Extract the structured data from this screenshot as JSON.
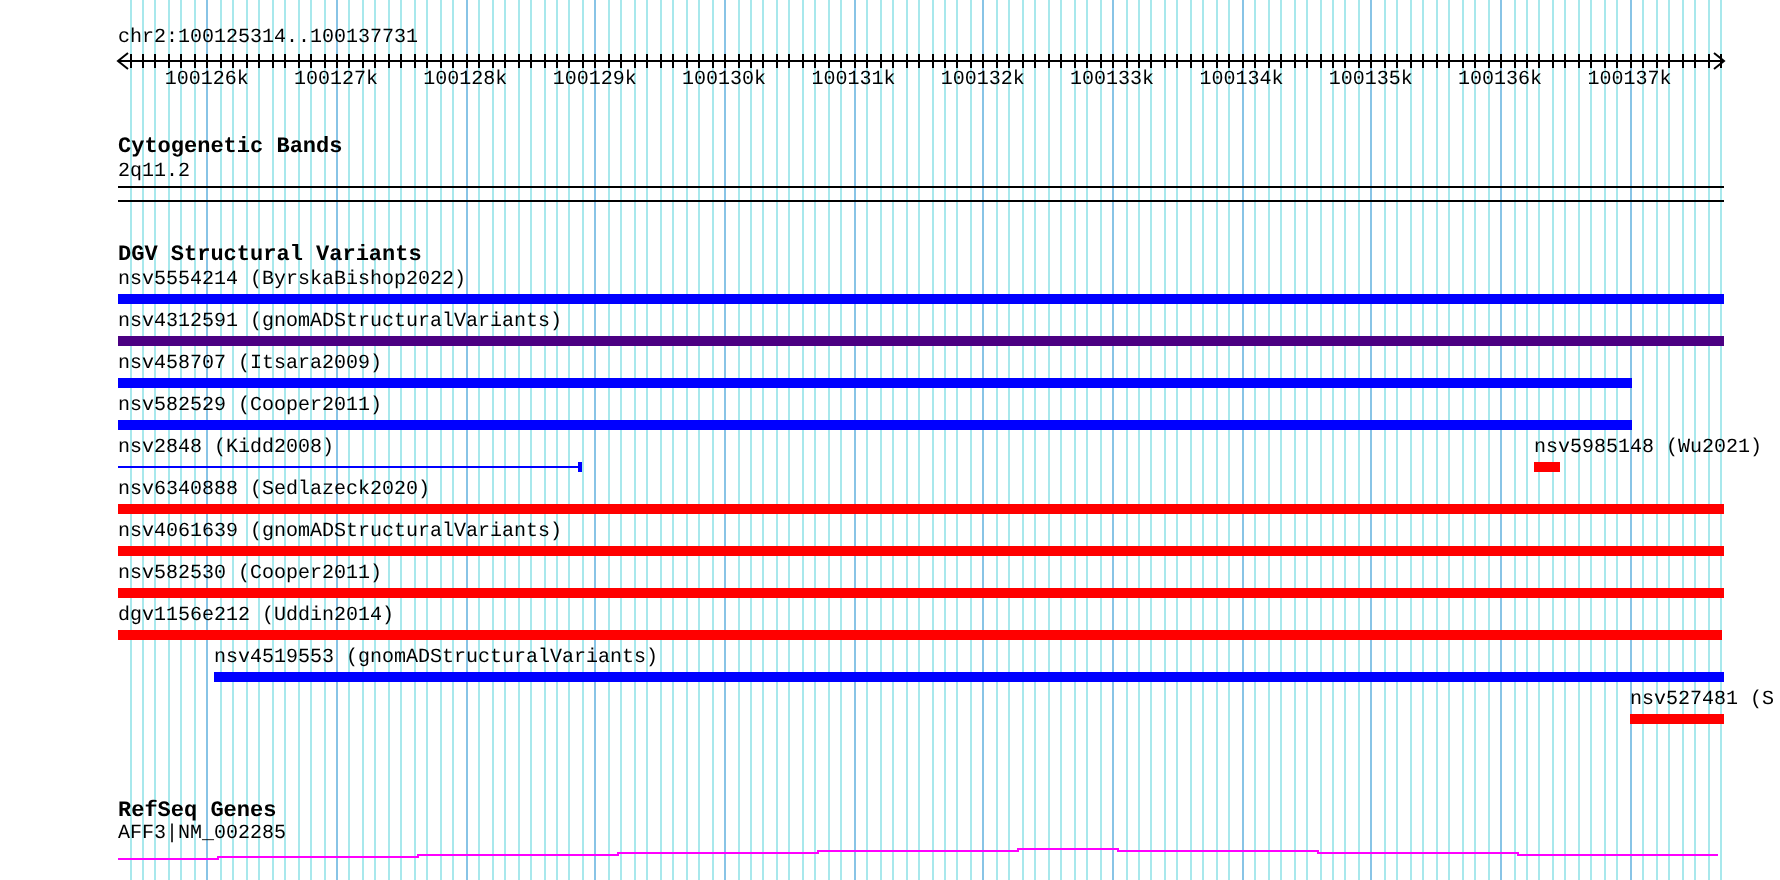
{
  "location": "chr2:100125314..100137731",
  "ruler": {
    "ticks": [
      "100126k",
      "100127k",
      "100128k",
      "100129k",
      "100130k",
      "100131k",
      "100132k",
      "100133k",
      "100134k",
      "100135k",
      "100136k",
      "100137k"
    ]
  },
  "tracks": [
    {
      "kind": "bands",
      "title": "Cytogenetic Bands",
      "features": [
        {
          "label": "2q11.2"
        }
      ]
    },
    {
      "kind": "variants",
      "title": "DGV Structural Variants",
      "features": [
        {
          "label": "nsv5554214 (ByrskaBishop2022)",
          "kind": "bar",
          "color": "#0000ff"
        },
        {
          "label": "nsv4312591 (gnomADStructuralVariants)",
          "kind": "bar",
          "color": "#4b0082"
        },
        {
          "label": "nsv458707 (Itsara2009)",
          "kind": "bar",
          "color": "#0000ff"
        },
        {
          "label": "nsv582529 (Cooper2011)",
          "kind": "bar",
          "color": "#0000ff"
        },
        {
          "label": "nsv2848 (Kidd2008)",
          "kind": "line",
          "color": "#0000ff"
        },
        {
          "label": "nsv5985148 (Wu2021)",
          "kind": "bar",
          "color": "#ff0000"
        },
        {
          "label": "nsv6340888 (Sedlazeck2020)",
          "kind": "bar",
          "color": "#ff0000"
        },
        {
          "label": "nsv4061639 (gnomADStructuralVariants)",
          "kind": "bar",
          "color": "#ff0000"
        },
        {
          "label": "nsv582530 (Cooper2011)",
          "kind": "bar",
          "color": "#ff0000"
        },
        {
          "label": "dgv1156e212 (Uddin2014)",
          "kind": "bar",
          "color": "#ff0000"
        },
        {
          "label": "nsv4519553 (gnomADStructuralVariants)",
          "kind": "bar",
          "color": "#0000ff"
        },
        {
          "label": "nsv527481 (S",
          "kind": "bar",
          "color": "#ff0000"
        }
      ]
    },
    {
      "kind": "genes",
      "title": "RefSeq Genes",
      "features": [
        {
          "label": "AFF3|NM_002285",
          "color": "#ff00ff"
        }
      ]
    }
  ]
}
